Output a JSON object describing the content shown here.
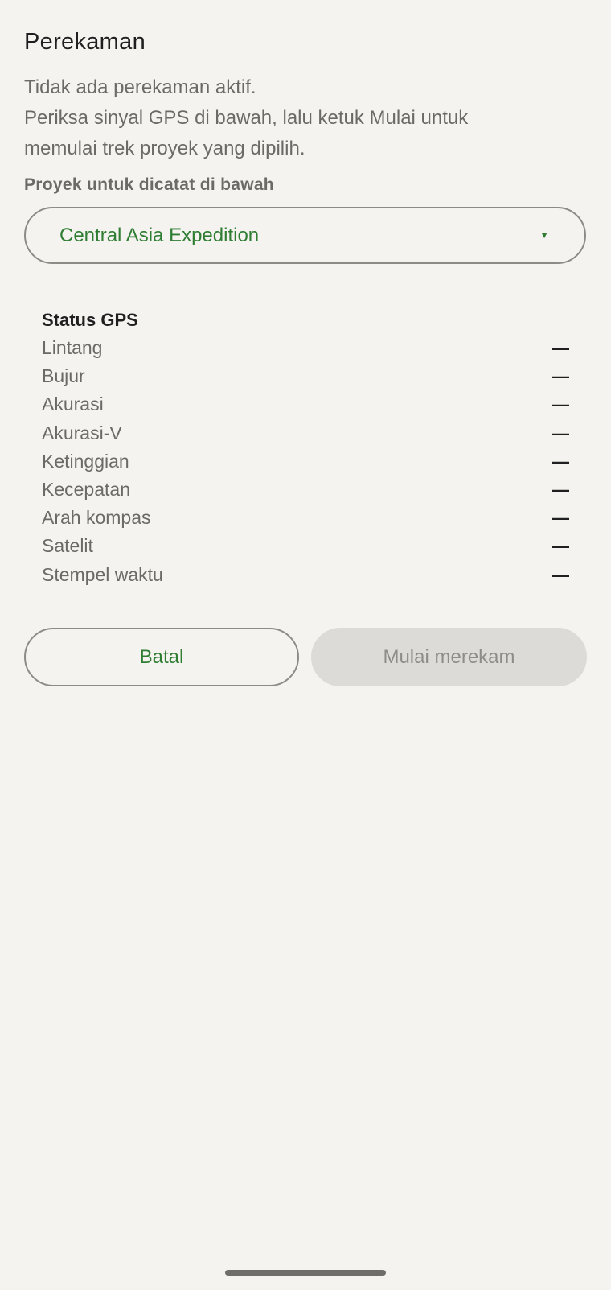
{
  "header": {
    "title": "Perekaman"
  },
  "description": {
    "line1": "Tidak ada perekaman aktif.",
    "line2": "Periksa sinyal GPS di bawah, lalu ketuk Mulai untuk",
    "line3": "memulai trek proyek yang dipilih."
  },
  "project": {
    "label": "Proyek untuk dicatat di bawah",
    "selected": "Central Asia Expedition",
    "caret": "▼"
  },
  "gps": {
    "title": "Status GPS",
    "rows": [
      {
        "label": "Lintang",
        "value": "—"
      },
      {
        "label": "Bujur",
        "value": "—"
      },
      {
        "label": "Akurasi",
        "value": "—"
      },
      {
        "label": "Akurasi-V",
        "value": "—"
      },
      {
        "label": "Ketinggian",
        "value": "—"
      },
      {
        "label": "Kecepatan",
        "value": "—"
      },
      {
        "label": "Arah kompas",
        "value": "—"
      },
      {
        "label": "Satelit",
        "value": "—"
      },
      {
        "label": "Stempel waktu",
        "value": "—"
      }
    ]
  },
  "actions": {
    "cancel_label": "Batal",
    "start_label": "Mulai merekam"
  },
  "colors": {
    "accent": "#2e7d32",
    "background": "#f4f3f0",
    "disabled_bg": "#dcdbd8",
    "disabled_text": "#8e8d89",
    "border": "#8d8b86"
  }
}
